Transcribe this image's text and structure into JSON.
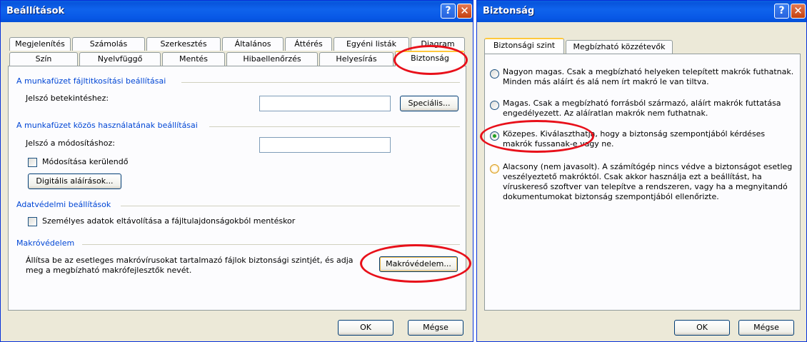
{
  "settings_dialog": {
    "title": "Beállítások",
    "help_label": "?",
    "close_label": "✕",
    "tabs_back": [
      "Megjelenítés",
      "Számolás",
      "Szerkesztés",
      "Általános",
      "Áttérés",
      "Egyéni listák",
      "Diagram"
    ],
    "tabs_front": [
      "Szín",
      "Nyelvfüggő",
      "Mentés",
      "Hibaellenőrzés",
      "Helyesírás",
      "Biztonság"
    ],
    "active_tab": "Biztonság",
    "encryption": {
      "title": "A munkafüzet fájltitkosítási beállításai",
      "password_label": "Jelszó betekintéshez:",
      "password_value": "",
      "advanced_button": "Speciális..."
    },
    "sharing": {
      "title": "A munkafüzet közös használatának beállításai",
      "password_label": "Jelszó a módosításhoz:",
      "password_value": "",
      "read_only_label": "Módosítása kerülendő",
      "read_only_checked": false,
      "signatures_button": "Digitális aláírások..."
    },
    "privacy": {
      "title": "Adatvédelmi beállítások",
      "remove_info_label": "Személyes adatok eltávolítása a fájltulajdonságokból mentéskor",
      "remove_info_checked": false
    },
    "macro": {
      "title": "Makróvédelem",
      "description": "Állítsa be az esetleges makróvírusokat tartalmazó fájlok biztonsági szintjét, és adja meg a megbízható makrófejlesztők nevét.",
      "button": "Makróvédelem..."
    },
    "ok_button": "OK",
    "cancel_button": "Mégse"
  },
  "security_dialog": {
    "title": "Biztonság",
    "help_label": "?",
    "close_label": "✕",
    "tabs": [
      "Biztonsági szint",
      "Megbízható közzétevők"
    ],
    "active_tab": "Biztonsági szint",
    "options": [
      {
        "text": "Nagyon magas. Csak a megbízható helyeken telepített makrók futhatnak. Minden más aláírt és alá nem írt makró le van tiltva.",
        "selected": false
      },
      {
        "text": "Magas. Csak a megbízható forrásból származó, aláírt makrók futtatása engedélyezett. Az aláíratlan makrók nem futhatnak.",
        "selected": false
      },
      {
        "text": "Közepes. Kiválaszthatja, hogy a biztonság szempontjából kérdéses makrók fussanak-e vagy ne.",
        "selected": true
      },
      {
        "text": "Alacsony (nem javasolt). A számítógép nincs védve a biztonságot esetleg veszélyeztető makróktól. Csak akkor használja ezt a beállítást, ha víruskereső szoftver van telepítve a rendszeren, vagy ha a megnyitandó dokumentumokat biztonság szempontjából ellenőrizte.",
        "selected": false
      }
    ],
    "ok_button": "OK",
    "cancel_button": "Mégse"
  },
  "colors": {
    "titlebar": "#0855dd",
    "dialog_bg": "#ece9d8",
    "group_title": "#0046d5",
    "highlight": "#e8101a"
  }
}
